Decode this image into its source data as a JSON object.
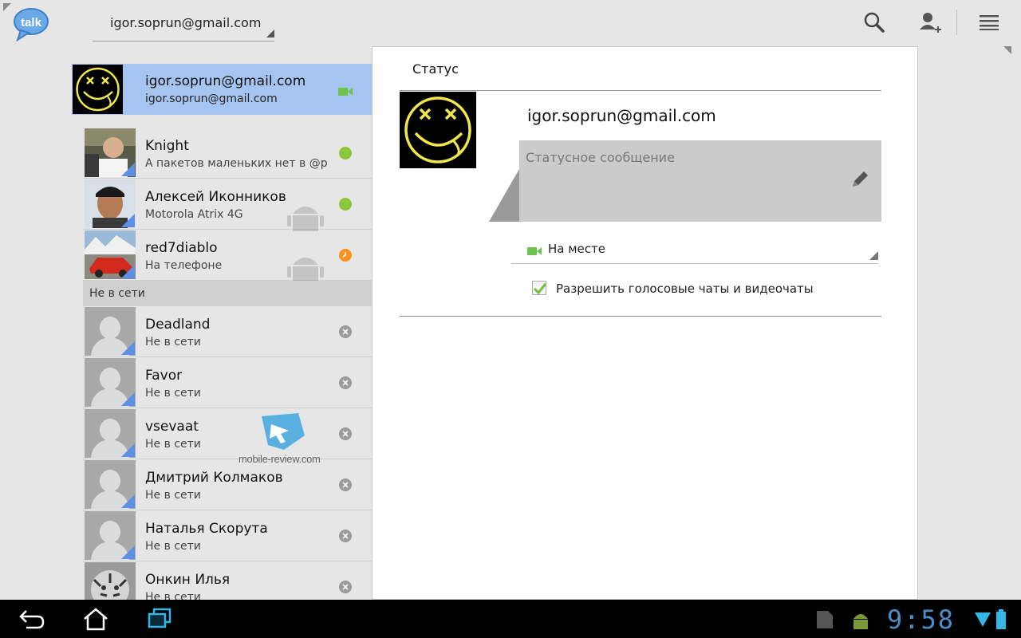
{
  "app": {
    "logo_text": "talk"
  },
  "actionbar": {
    "account": "igor.soprun@gmail.com",
    "search_icon": "search-icon",
    "add_contact_icon": "add-contact-icon",
    "menu_icon": "menu-icon"
  },
  "self": {
    "name": "igor.soprun@gmail.com",
    "subtitle": "igor.soprun@gmail.com",
    "presence_icon": "video-icon"
  },
  "contacts_online": [
    {
      "name": "Knight",
      "status": "А пакетов маленьких нет в @pere",
      "presence": "available",
      "presence_color": "#8cc63f",
      "device": ""
    },
    {
      "name": "Алексей Иконников",
      "status": "Motorola Atrix 4G",
      "presence": "available",
      "presence_color": "#8cc63f",
      "device": "android"
    },
    {
      "name": "red7diablo",
      "status": "На телефоне",
      "presence": "away",
      "presence_color": "#f7941d",
      "device": "android"
    }
  ],
  "offline_header": "Не в сети",
  "contacts_offline": [
    {
      "name": "Deadland",
      "status": "Не в сети"
    },
    {
      "name": "Favor",
      "status": "Не в сети"
    },
    {
      "name": "vsevaat",
      "status": "Не в сети"
    },
    {
      "name": "Дмитрий Колмаков",
      "status": "Не в сети"
    },
    {
      "name": "Наталья Скорута",
      "status": "Не в сети"
    },
    {
      "name": "Онкин Илья",
      "status": "Не в сети"
    }
  ],
  "panel": {
    "title": "Статус",
    "email": "igor.soprun@gmail.com",
    "status_placeholder": "Статусное сообщение",
    "presence_value": "На месте",
    "voice_video_label": "Разрешить голосовые чаты и видеочаты",
    "voice_video_checked": true
  },
  "watermark": {
    "text": "mobile-review.com"
  },
  "system_bar": {
    "time": "9:58",
    "back_icon": "back-icon",
    "home_icon": "home-icon",
    "recent_icon": "recent-apps-icon"
  },
  "colors": {
    "selected_row": "#a6c4f0",
    "available": "#8cc63f",
    "away": "#f7941d",
    "offline": "#9a9a9a",
    "accent_blue": "#5b8fe8",
    "clock": "#4a8fc8"
  }
}
